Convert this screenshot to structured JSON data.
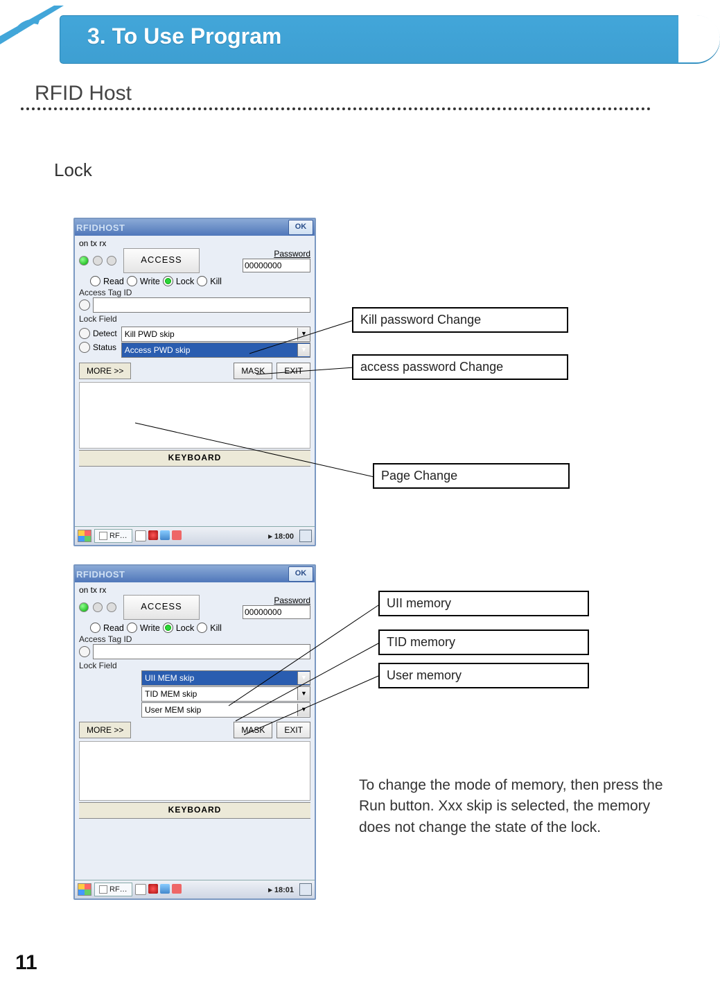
{
  "header": {
    "title": "3. To Use Program"
  },
  "section": {
    "title": "RFID Host",
    "subtitle": "Lock"
  },
  "page_number": "11",
  "device_common": {
    "window_title": "RFIDHOST",
    "ok": "OK",
    "status_header": "on tx rx",
    "access_button": "ACCESS",
    "password_label": "Password",
    "password_value": "00000000",
    "radios": {
      "read": "Read",
      "write": "Write",
      "lock": "Lock",
      "kill": "Kill"
    },
    "access_tag_id_label": "Access Tag ID",
    "lock_field_label": "Lock Field",
    "detect_label": "Detect",
    "status_label": "Status",
    "more": "MORE >>",
    "mask": "MASK",
    "exit": "EXIT",
    "keyboard": "KEYBOARD",
    "task_label": "RF…"
  },
  "device1": {
    "dropdowns": {
      "opt1": "Kill PWD skip",
      "opt2": "Access PWD skip"
    },
    "clock": "18:00"
  },
  "device2": {
    "dropdowns": {
      "opt1": "UII MEM skip",
      "opt2": "TID MEM skip",
      "opt3": "User MEM skip"
    },
    "clock": "18:01"
  },
  "callouts": {
    "c1": "Kill password Change",
    "c2": "access password Change",
    "c3": "Page Change",
    "c4": "UII memory",
    "c5": "TID memory",
    "c6": "User memory"
  },
  "bodytext": "To change the mode of memory, then press the Run button. Xxx skip is selected, the memory does not change the state of the lock."
}
